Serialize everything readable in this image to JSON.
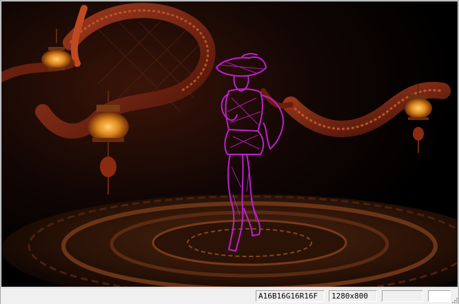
{
  "statusbar": {
    "pixel_format": "A16B16G16R16F",
    "resolution": "1280x800",
    "panel3": "",
    "panel4": ""
  },
  "viewport": {
    "scene": "game-scene-dragon-stage",
    "colors": {
      "background": "#000000",
      "wireframe": "#c020d0",
      "lantern": "#f0a020",
      "dragon": "#8a2a10",
      "floor": "#3a1a0a"
    }
  }
}
